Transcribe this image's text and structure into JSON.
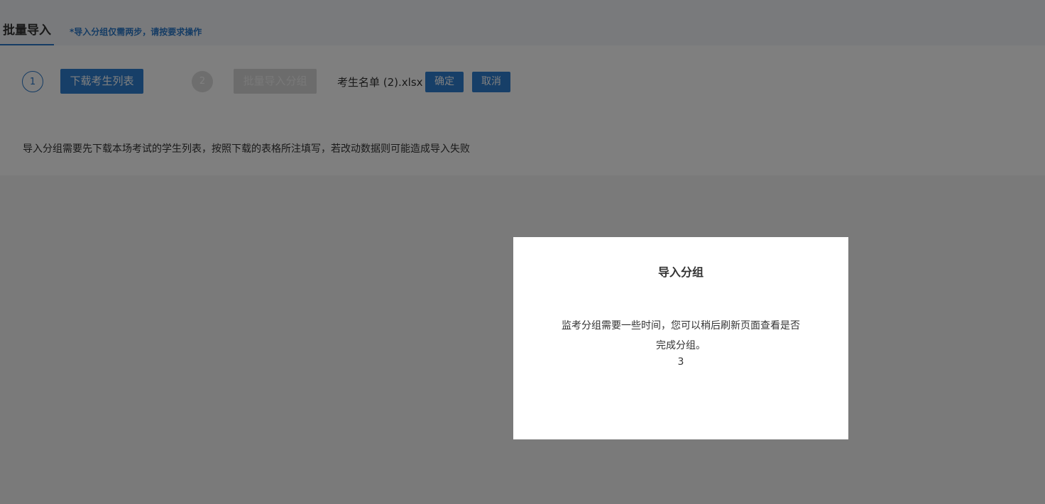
{
  "header": {
    "active_tab": "批量导入",
    "hint": "*导入分组仅需两步，请按要求操作"
  },
  "steps": {
    "step1_number": "1",
    "download_button": "下载考生列表",
    "step2_number": "2",
    "import_button": "批量导入分组",
    "file_name": "考生名单 (2).xlsx",
    "confirm_button": "确定",
    "cancel_button": "取消"
  },
  "note": "导入分组需要先下载本场考试的学生列表，按照下载的表格所注填写，若改动数据则可能造成导入失败",
  "modal": {
    "title": "导入分组",
    "message": "监考分组需要一些时间，您可以稍后刷新页面查看是否完成分组。",
    "countdown": "3"
  },
  "colors": {
    "accent": "#2e7fd0",
    "overlay": "rgba(0,0,0,0.5)"
  }
}
